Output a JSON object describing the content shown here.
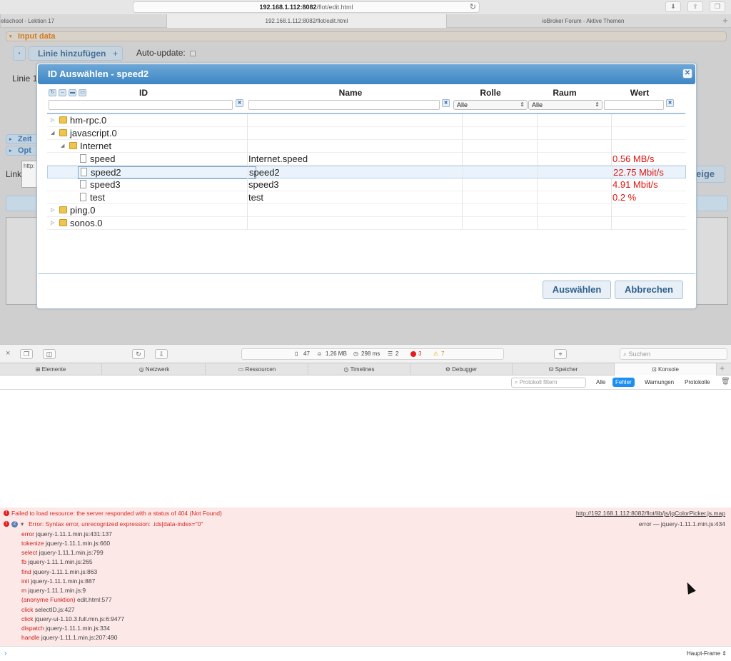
{
  "browser": {
    "url_host": "192.168.1.112:8082",
    "url_path": "/flot/edit.html",
    "tabs": [
      "elischool - Lektion 17",
      "192.168.1.112:8082/flot/edit.html",
      "ioBroker Forum - Aktive Themen"
    ]
  },
  "page": {
    "input_data": "Input data",
    "add_line": "Linie hinzufügen",
    "auto_update": "Auto-update:",
    "line_label": "Linie 1",
    "section_time": "Zeit",
    "section_options": "Opt",
    "link_label": "Link",
    "link_value": "http:",
    "show_button": "eige"
  },
  "dialog": {
    "title": "ID Auswählen - speed2",
    "columns": {
      "id": "ID",
      "name": "Name",
      "role": "Rolle",
      "room": "Raum",
      "value": "Wert"
    },
    "role_filter": "Alle",
    "room_filter": "Alle",
    "rows": [
      {
        "id": "hm-rpc.0",
        "name": "",
        "value": ""
      },
      {
        "id": "javascript.0",
        "name": "",
        "value": ""
      },
      {
        "id": "Internet",
        "name": "",
        "value": ""
      },
      {
        "id": "speed",
        "name": "Internet.speed",
        "value": "0.56 MB/s"
      },
      {
        "id": "speed2",
        "name": "speed2",
        "value": "22.75 Mbit/s"
      },
      {
        "id": "speed3",
        "name": "speed3",
        "value": "4.91 Mbit/s"
      },
      {
        "id": "test",
        "name": "test",
        "value": "0.2 %"
      },
      {
        "id": "ping.0",
        "name": "",
        "value": ""
      },
      {
        "id": "sonos.0",
        "name": "",
        "value": ""
      }
    ],
    "select_button": "Auswählen",
    "cancel_button": "Abbrechen"
  },
  "inspector": {
    "stats": {
      "resources": "47",
      "size": "1.26 MB",
      "time": "298 ms",
      "logs": "2",
      "errors": "3",
      "warnings": "7"
    },
    "search_placeholder": "Suchen",
    "tabs": [
      "Elemente",
      "Netzwerk",
      "Ressourcen",
      "Timelines",
      "Debugger",
      "Speicher",
      "Konsole"
    ],
    "filter_placeholder": "Protokoll filtern",
    "filters": [
      "Alle",
      "Fehler",
      "Warnungen",
      "Protokolle"
    ],
    "error1": "Failed to load resource: the server responded with a status of 404 (Not Found)",
    "error1_link": "http://192.168.1.112:8082/flot/lib/js/jqColorPicker.js.map",
    "error2_count": "2",
    "error2": "Error: Syntax error, unrecognized expression: .ids[data-index=\"0\"",
    "error2_source": "error — jquery-1.11.1.min.js:434",
    "trace": [
      {
        "fn": "error",
        "loc": "jquery-1.11.1.min.js:431:137"
      },
      {
        "fn": "tokenize",
        "loc": "jquery-1.11.1.min.js:660"
      },
      {
        "fn": "select",
        "loc": "jquery-1.11.1.min.js:799"
      },
      {
        "fn": "fb",
        "loc": "jquery-1.11.1.min.js:265"
      },
      {
        "fn": "find",
        "loc": "jquery-1.11.1.min.js:863"
      },
      {
        "fn": "init",
        "loc": "jquery-1.11.1.min.js:887"
      },
      {
        "fn": "m",
        "loc": "jquery-1.11.1.min.js:9"
      },
      {
        "fn": "(anonyme Funktion)",
        "loc": "edit.html:577"
      },
      {
        "fn": "click",
        "loc": "selectID.js:427"
      },
      {
        "fn": "click",
        "loc": "jquery-ui-1.10.3.full.min.js:6:9477"
      },
      {
        "fn": "dispatch",
        "loc": "jquery-1.11.1.min.js:334"
      },
      {
        "fn": "handle",
        "loc": "jquery-1.11.1.min.js:207:490"
      }
    ],
    "frame": "Haupt-Frame"
  }
}
